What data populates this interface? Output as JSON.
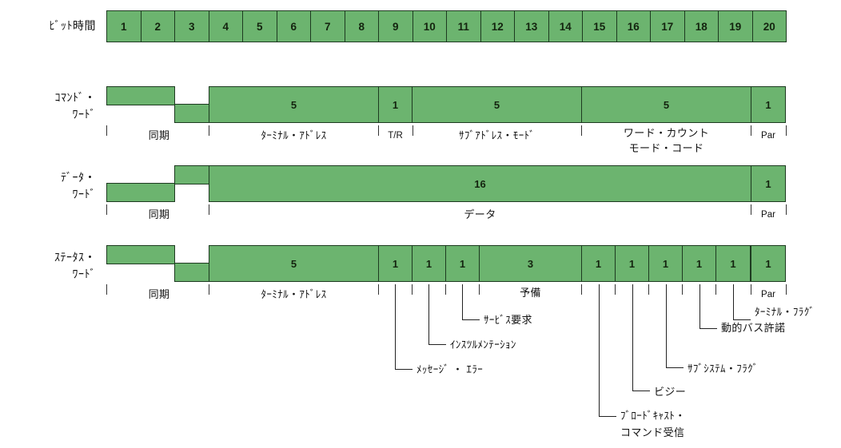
{
  "diagram": {
    "title": "MIL-STD-1553 word formats",
    "accent_color": "#6CB46F",
    "border_color": "#1d3a20"
  },
  "bit_time_row": {
    "label": "ﾋﾞｯﾄ時間",
    "bits": [
      "1",
      "2",
      "3",
      "4",
      "5",
      "6",
      "7",
      "8",
      "9",
      "10",
      "11",
      "12",
      "13",
      "14",
      "15",
      "16",
      "17",
      "18",
      "19",
      "20"
    ]
  },
  "command_word": {
    "label": "ｺﾏﾝﾄﾞ・\nﾜｰﾄﾞ",
    "sync_caption": "同期",
    "fields": [
      {
        "width_label": "5",
        "caption": "ﾀｰﾐﾅﾙ・ｱﾄﾞﾚｽ"
      },
      {
        "width_label": "1",
        "caption": "T/R"
      },
      {
        "width_label": "5",
        "caption": "ｻﾌﾞｱﾄﾞﾚｽ・ﾓｰﾄﾞ"
      },
      {
        "width_label": "5",
        "caption": "ワード・カウント\nモード・コード"
      },
      {
        "width_label": "1",
        "caption": "Par"
      }
    ]
  },
  "data_word": {
    "label": "ﾃﾞｰﾀ・\nﾜｰﾄﾞ",
    "sync_caption": "同期",
    "fields": [
      {
        "width_label": "16",
        "caption": "データ"
      },
      {
        "width_label": "1",
        "caption": "Par"
      }
    ]
  },
  "status_word": {
    "label": "ｽﾃｰﾀｽ・\nﾜｰﾄﾞ",
    "sync_caption": "同期",
    "fields": [
      {
        "width_label": "5",
        "caption": "ﾀｰﾐﾅﾙ・ｱﾄﾞﾚｽ"
      },
      {
        "width_label": "1",
        "caption": ""
      },
      {
        "width_label": "1",
        "caption": ""
      },
      {
        "width_label": "1",
        "caption": ""
      },
      {
        "width_label": "3",
        "caption": "予備"
      },
      {
        "width_label": "1",
        "caption": ""
      },
      {
        "width_label": "1",
        "caption": ""
      },
      {
        "width_label": "1",
        "caption": ""
      },
      {
        "width_label": "1",
        "caption": ""
      },
      {
        "width_label": "1",
        "caption": ""
      },
      {
        "width_label": "1",
        "caption": "Par"
      }
    ],
    "callouts": [
      {
        "text": "ｻｰﾋﾞｽ要求"
      },
      {
        "text": "ｲﾝｽﾂﾙﾒﾝﾃｰｼｮﾝ"
      },
      {
        "text": "ﾒｯｾｰｼﾞ ・ ｴﾗｰ"
      },
      {
        "text": "ﾀｰﾐﾅﾙ・ﾌﾗｸﾞ"
      },
      {
        "text": "動的バス許諾"
      },
      {
        "text": "ｻﾌﾞｼｽﾃﾑ・ﾌﾗｸﾞ"
      },
      {
        "text": "ビジー"
      },
      {
        "text": "ﾌﾞﾛｰﾄﾞｷｬｽﾄ・\nコマンド受信"
      }
    ]
  }
}
